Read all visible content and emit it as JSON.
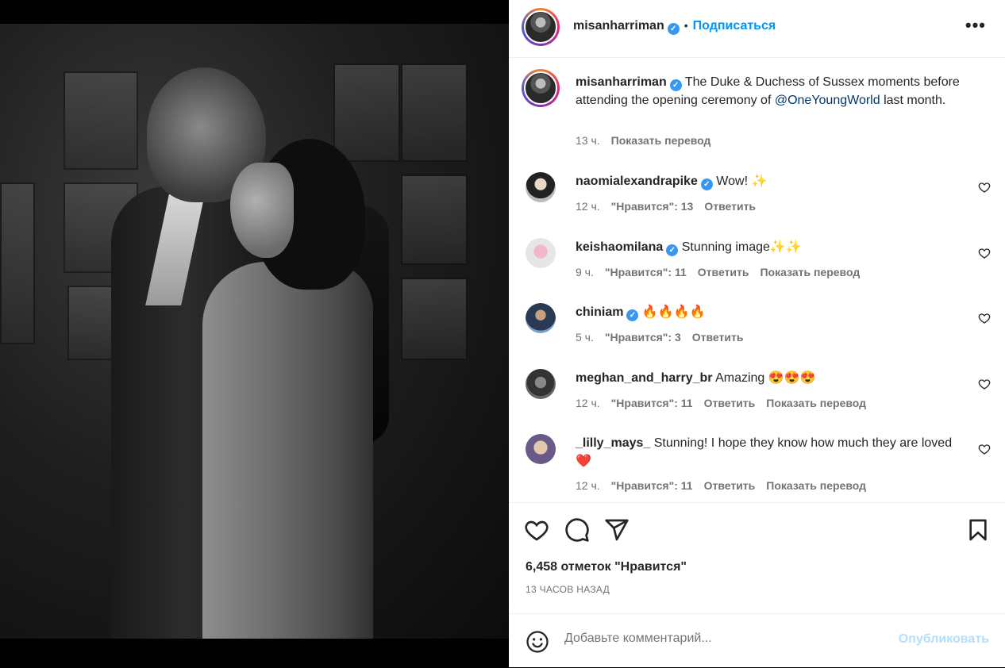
{
  "post": {
    "author": "misanharriman",
    "follow_label": "Подписаться",
    "dot": "•",
    "more": "•••"
  },
  "caption": {
    "author": "misanharriman",
    "text_before": "The Duke & Duchess of Sussex moments before attending the opening ceremony of ",
    "mention": "@OneYoungWorld",
    "text_after": " last month.",
    "time": "13 ч.",
    "translate": "Показать перевод"
  },
  "comments": [
    {
      "user": "naomialexandrapike",
      "text": "Wow! ✨",
      "time": "12 ч.",
      "likes": "\"Нравится\": 13",
      "reply": "Ответить",
      "translate": ""
    },
    {
      "user": "keishaomilana",
      "text": "Stunning image✨✨",
      "time": "9 ч.",
      "likes": "\"Нравится\": 11",
      "reply": "Ответить",
      "translate": "Показать перевод"
    },
    {
      "user": "chiniam",
      "text": "🔥🔥🔥🔥",
      "time": "5 ч.",
      "likes": "\"Нравится\": 3",
      "reply": "Ответить",
      "translate": ""
    },
    {
      "user": "meghan_and_harry_br",
      "text": "Amazing 😍😍😍",
      "time": "12 ч.",
      "likes": "\"Нравится\": 11",
      "reply": "Ответить",
      "translate": "Показать перевод"
    },
    {
      "user": "_lilly_mays_",
      "text": "Stunning! I hope they know how much they are loved ❤️",
      "time": "12 ч.",
      "likes": "\"Нравится\": 11",
      "reply": "Ответить",
      "translate": "Показать перевод"
    }
  ],
  "likes_count": "6,458 отметок \"Нравится\"",
  "posted_ago": "13 ЧАСОВ НАЗАД",
  "composer": {
    "placeholder": "Добавьте комментарий...",
    "publish": "Опубликовать"
  },
  "icons": [
    "verified-badge-icon",
    "more-options-icon",
    "like-icon",
    "comment-icon",
    "share-icon",
    "save-icon",
    "emoji-icon",
    "comment-like-icon"
  ]
}
